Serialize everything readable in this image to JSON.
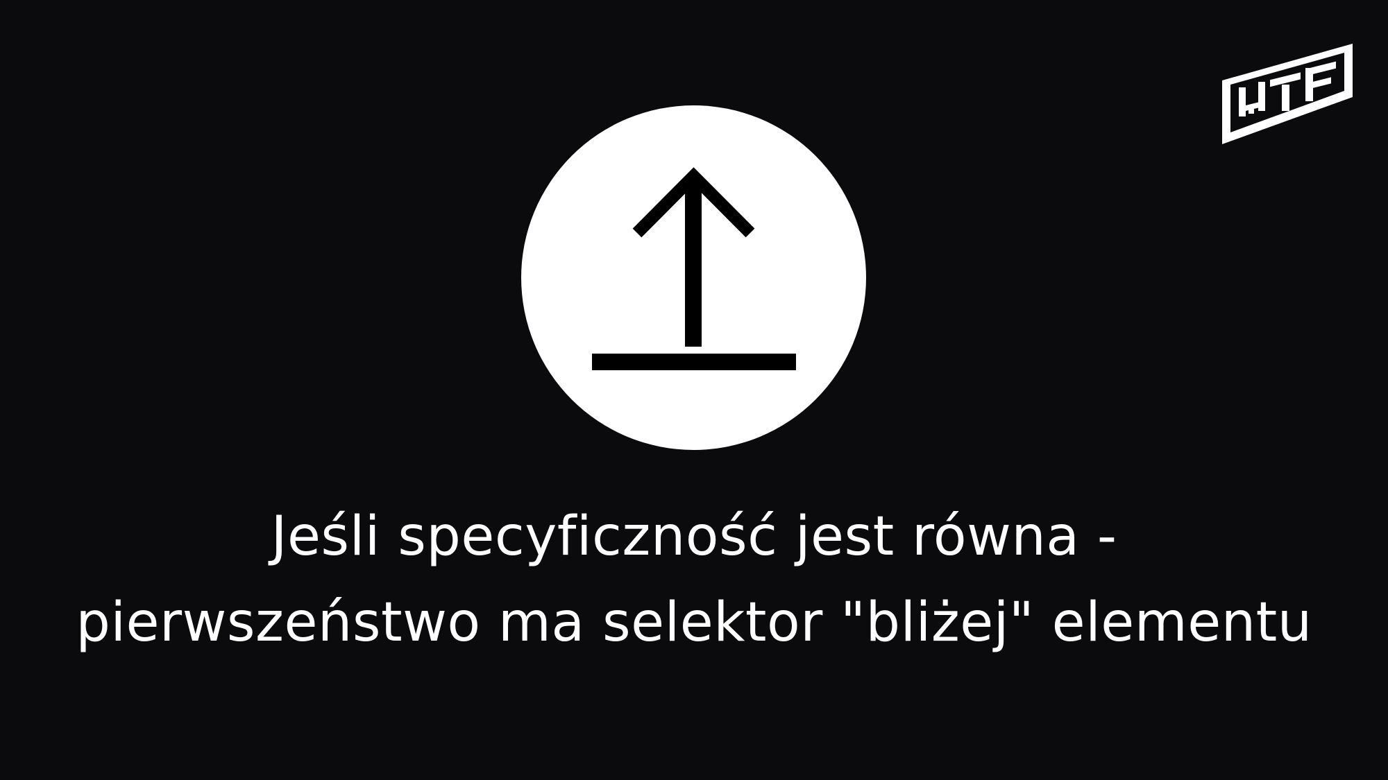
{
  "slide": {
    "logo_text": "WTF",
    "icon": "upload-arrow-icon",
    "caption": "Jeśli specyficzność jest równa - pierwszeństwo ma selektor \"bliżej\" elementu"
  },
  "colors": {
    "background": "#0b0a0d",
    "foreground": "#ffffff"
  }
}
